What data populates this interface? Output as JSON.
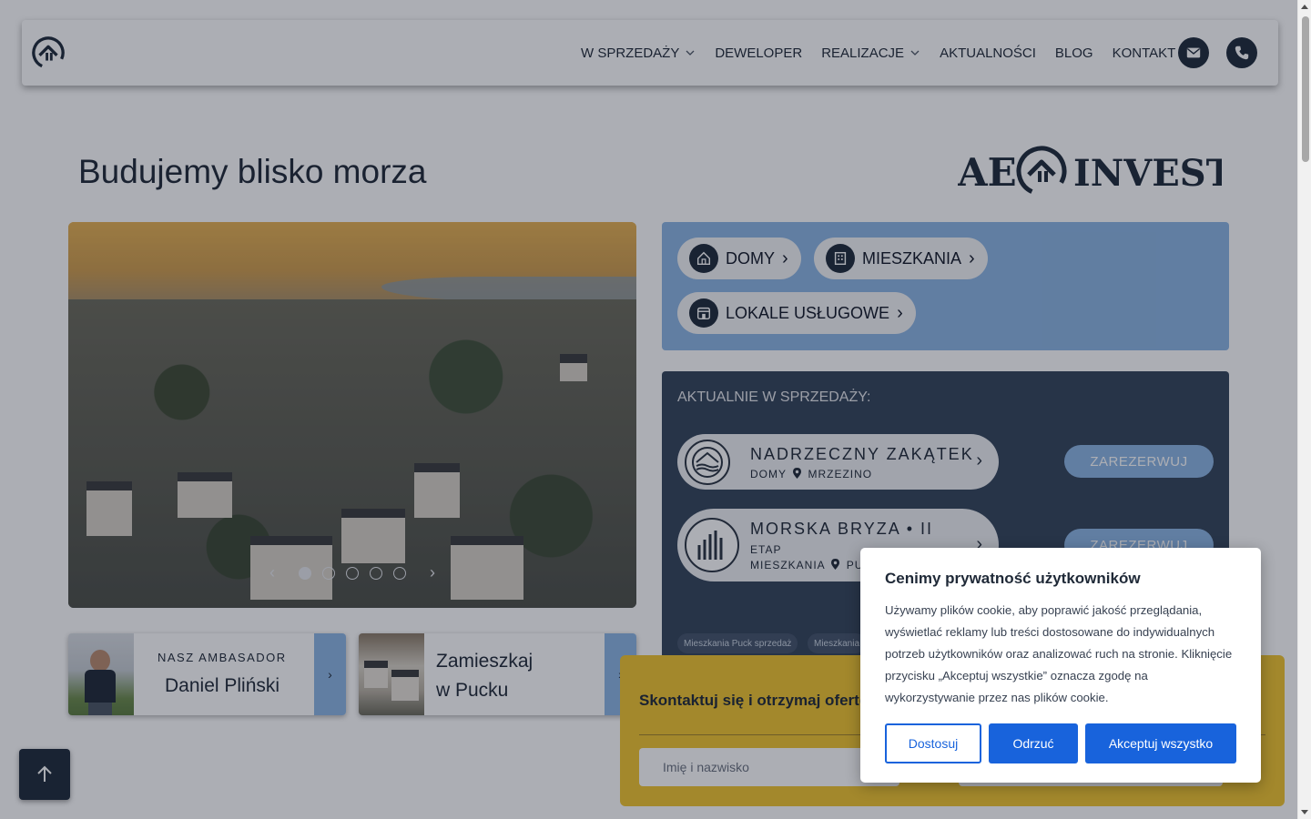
{
  "nav": {
    "items": [
      {
        "label": "W SPRZEDAŻY",
        "dropdown": true
      },
      {
        "label": "DEWELOPER",
        "dropdown": false
      },
      {
        "label": "REALIZACJE",
        "dropdown": true
      },
      {
        "label": "AKTUALNOŚCI",
        "dropdown": false
      },
      {
        "label": "BLOG",
        "dropdown": false
      },
      {
        "label": "KONTAKT",
        "dropdown": false
      }
    ]
  },
  "hero": {
    "title": "Budujemy blisko morza",
    "brand_left": "AE",
    "brand_right": "INVEST",
    "slider": {
      "slide_count": 5,
      "active_slide": 1
    }
  },
  "categories": [
    {
      "label": "DOMY",
      "icon": "house-icon"
    },
    {
      "label": "MIESZKANIA",
      "icon": "building-icon"
    },
    {
      "label": "LOKALE USŁUGOWE",
      "icon": "shop-icon"
    }
  ],
  "sale": {
    "title": "AKTUALNIE W SPRZEDAŻY:",
    "items": [
      {
        "name": "NADRZECZNY ZAKĄTEK",
        "type": "DOMY",
        "location": "MRZEZINO",
        "reserve": "ZAREZERWUJ"
      },
      {
        "name": "MORSKA BRYZA • II",
        "stage": "ETAP",
        "type": "MIESZKANIA",
        "location": "PU",
        "reserve": "ZAREZERWUJ"
      }
    ],
    "tags": [
      "Mieszkania Puck sprzedaż",
      "Mieszkania"
    ]
  },
  "cards": [
    {
      "small": "NASZ AMBASADOR",
      "big": "Daniel Pliński"
    },
    {
      "line1": "Zamieszkaj",
      "line2": "w Pucku"
    }
  ],
  "contact": {
    "title": "Skontaktuj się i otrzymaj oferte",
    "name_placeholder": "Imię i nazwisko"
  },
  "cookie": {
    "title": "Cenimy prywatność użytkowników",
    "text": "Używamy plików cookie, aby poprawić jakość przeglądania, wyświetlać reklamy lub treści dostosowane do indywidualnych potrzeb użytkowników oraz analizować ruch na stronie. Kliknięcie przycisku „Akceptuj wszystkie” oznacza zgodę na wykorzystywanie przez nas plików cookie.",
    "customize": "Dostosuj",
    "reject": "Odrzuć",
    "accept": "Akceptuj wszystko"
  },
  "colors": {
    "navy": "#1e2a3a",
    "light_blue": "#8cb5e3",
    "sale_bg": "#34445a",
    "yellow": "#f1c52f",
    "cookie_blue": "#1863dc"
  }
}
